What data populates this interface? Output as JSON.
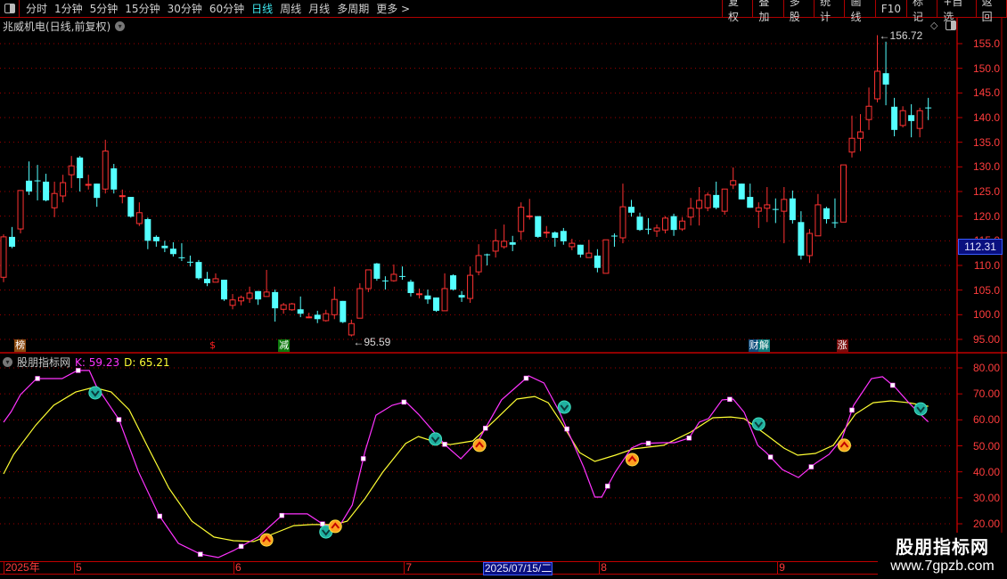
{
  "toolbar": {
    "periods": [
      "分时",
      "1分钟",
      "5分钟",
      "15分钟",
      "30分钟",
      "60分钟",
      "日线",
      "周线",
      "月线",
      "多周期",
      "更多 >"
    ],
    "active_period": "日线",
    "buttons": [
      "复权",
      "叠加",
      "多股",
      "统计",
      "画线",
      "F10",
      "标记",
      "+自选",
      "返回"
    ]
  },
  "chart_title": "兆威机电(日线,前复权)",
  "indicator": {
    "name": "股朋指标网",
    "k_label": "K: 59.23",
    "d_label": "D: 65.21"
  },
  "price_axis": {
    "labels": [
      "155.0",
      "150.0",
      "145.0",
      "140.0",
      "135.0",
      "130.0",
      "125.0",
      "120.0",
      "115.0",
      "110.0",
      "105.0",
      "100.0",
      "95.00"
    ],
    "current_price": "112.31"
  },
  "indicator_axis": {
    "labels": [
      "80.00",
      "70.00",
      "60.00",
      "50.00",
      "40.00",
      "30.00",
      "20.00"
    ]
  },
  "annotations": {
    "high": "156.72",
    "low": "95.59"
  },
  "event_marks": [
    {
      "text": "榜",
      "bar": 1.9,
      "bg": "#8b4a10",
      "color": "#ffffff"
    },
    {
      "text": "$",
      "bar": 24.8,
      "bg": "transparent",
      "color": "#ff2020"
    },
    {
      "text": "减",
      "bar": 33,
      "bg": "#0c7a0c",
      "color": "#ffffff"
    },
    {
      "text": "财",
      "bar": 88.4,
      "bg": "#0c4a7a",
      "color": "#ffffff"
    },
    {
      "text": "解",
      "bar": 89.6,
      "bg": "#0c7a7a",
      "color": "#ffffff"
    },
    {
      "text": "涨",
      "bar": 98.8,
      "bg": "#7a0c0c",
      "color": "#ffffff"
    }
  ],
  "time_axis": [
    {
      "text": "2025年",
      "bar": 0
    },
    {
      "text": "5",
      "bar": 8.3
    },
    {
      "text": "6",
      "bar": 27.1
    },
    {
      "text": "7",
      "bar": 47.2
    },
    {
      "text": "2025/07/15/二",
      "bar": 56.5,
      "selected": true
    },
    {
      "text": "8",
      "bar": 70.2
    },
    {
      "text": "9",
      "bar": 91.2
    }
  ],
  "watermark": {
    "line1": "股朋指标网",
    "line2": "www.7gpzb.com"
  },
  "colors": {
    "up": "#ff3232",
    "down": "#54ffff",
    "k": "#ff33ff",
    "d": "#ffff33",
    "grid": "#a00000",
    "signal_buy": "#ffa020",
    "signal_sell": "#20b0a0"
  },
  "chart_data": {
    "type": "candlestick",
    "price_range": [
      95,
      155
    ],
    "ohlc": [
      [
        107.6,
        116.3,
        106.6,
        115.8
      ],
      [
        115.8,
        117.8,
        113.5,
        113.8
      ],
      [
        117.4,
        125.2,
        116.5,
        125.2
      ],
      [
        127.2,
        131.1,
        124.3,
        125
      ],
      [
        127.25,
        130.4,
        123.2,
        127.2
      ],
      [
        127,
        128.6,
        123,
        123.2
      ],
      [
        121.7,
        127,
        119.8,
        124.6
      ],
      [
        124.1,
        128.4,
        122.8,
        126.8
      ],
      [
        128.4,
        132.2,
        125.7,
        130.2
      ],
      [
        131.9,
        132.2,
        125,
        127.7
      ],
      [
        126.4,
        128.4,
        125.4,
        126.45
      ],
      [
        126.6,
        126.6,
        121.9,
        123.7
      ],
      [
        125.5,
        135.5,
        124.6,
        133.2
      ],
      [
        129.7,
        130.6,
        124.6,
        125.4
      ],
      [
        124.1,
        125.4,
        122.6,
        124.15
      ],
      [
        123.9,
        123.9,
        119.7,
        119.9
      ],
      [
        118.5,
        122.8,
        118,
        120.7
      ],
      [
        119.4,
        119.7,
        113.3,
        115
      ],
      [
        115.8,
        116.1,
        113.8,
        114.9
      ],
      [
        114,
        115,
        112.7,
        113.5
      ],
      [
        113.4,
        114.7,
        111.8,
        112.3
      ],
      [
        111.65,
        114.5,
        110.9,
        111.6
      ],
      [
        110.75,
        112,
        109.8,
        110.7
      ],
      [
        110.7,
        111.1,
        107.1,
        107.4
      ],
      [
        107.3,
        108.7,
        105.8,
        106.4
      ],
      [
        106.6,
        108.4,
        106.6,
        107.3
      ],
      [
        107.1,
        107.1,
        102.8,
        103.1
      ],
      [
        101.9,
        104.2,
        101.1,
        103
      ],
      [
        102.8,
        103.9,
        101.9,
        103.5
      ],
      [
        103.3,
        105.7,
        102.4,
        104.4
      ],
      [
        104.8,
        104.8,
        102,
        103.1
      ],
      [
        103.7,
        109.1,
        103.7,
        104.6
      ],
      [
        104.6,
        105.1,
        98.6,
        101.3
      ],
      [
        101.1,
        102.4,
        100.2,
        102
      ],
      [
        101,
        102.4,
        100.8,
        102.2
      ],
      [
        101.1,
        103.7,
        99.5,
        100.2
      ],
      [
        99.5,
        100.4,
        99.3,
        99.55
      ],
      [
        100,
        100.8,
        98.3,
        99.1
      ],
      [
        98.8,
        101,
        98.6,
        100.2
      ],
      [
        100,
        105.7,
        99.1,
        103.1
      ],
      [
        102.8,
        102.8,
        98.3,
        98.5
      ],
      [
        95.9,
        99,
        95.59,
        98.2
      ],
      [
        99.3,
        106.4,
        99.3,
        105.3
      ],
      [
        105.3,
        109.1,
        104.6,
        109.1
      ],
      [
        110.4,
        110.5,
        106.9,
        107.3
      ],
      [
        106.95,
        107.8,
        105.1,
        106.9
      ],
      [
        106.9,
        110.2,
        106.7,
        108.2
      ],
      [
        107.85,
        109.8,
        107.1,
        107.8
      ],
      [
        106.7,
        107.1,
        103.7,
        104.4
      ],
      [
        104.2,
        105.3,
        103.3,
        104.25
      ],
      [
        103.9,
        105.1,
        102.2,
        103.1
      ],
      [
        103.5,
        103.5,
        100.6,
        100.8
      ],
      [
        100.8,
        108.4,
        100.8,
        105.3
      ],
      [
        108,
        108.2,
        104.9,
        105.1
      ],
      [
        104,
        104.8,
        102.6,
        103.5
      ],
      [
        103.3,
        109.8,
        102.4,
        108
      ],
      [
        108.7,
        114.3,
        108,
        112
      ],
      [
        112.25,
        112.4,
        110,
        112.2
      ],
      [
        112.9,
        117.4,
        111.6,
        115
      ],
      [
        113.8,
        118.3,
        113.4,
        114.9
      ],
      [
        114.7,
        116,
        112.9,
        114.2
      ],
      [
        116.9,
        122.8,
        115.2,
        121.8
      ],
      [
        120,
        123.5,
        119.3,
        120.05
      ],
      [
        120,
        120,
        115.6,
        115.8
      ],
      [
        116.7,
        118,
        115.6,
        116.75
      ],
      [
        116.7,
        116.9,
        113.8,
        115.6
      ],
      [
        117,
        117.6,
        114.2,
        114.9
      ],
      [
        113.8,
        115.4,
        113.1,
        114.5
      ],
      [
        114.2,
        114.2,
        111.6,
        112.2
      ],
      [
        111.6,
        115.2,
        111.6,
        112.5
      ],
      [
        112,
        113.3,
        108.6,
        109.5
      ],
      [
        108.4,
        115.2,
        108.4,
        115.2
      ],
      [
        116.05,
        116.5,
        113.8,
        116
      ],
      [
        115.6,
        126.6,
        114.5,
        121.9
      ],
      [
        121.9,
        123.3,
        119.9,
        120.7
      ],
      [
        119.9,
        120.7,
        117,
        117.2
      ],
      [
        117.45,
        119.6,
        116.3,
        117.4
      ],
      [
        117,
        118.3,
        115.8,
        117.6
      ],
      [
        117.2,
        120,
        116.5,
        119.6
      ],
      [
        120,
        120.5,
        116,
        117.2
      ],
      [
        117.4,
        119.8,
        117,
        119
      ],
      [
        119.8,
        123.7,
        118.1,
        121.6
      ],
      [
        121.6,
        125.9,
        118.1,
        123.2
      ],
      [
        121.7,
        124.8,
        121,
        124.3
      ],
      [
        124.3,
        127,
        121.4,
        121.7
      ],
      [
        121,
        125.5,
        120.3,
        125.5
      ],
      [
        126.3,
        129.9,
        125.5,
        127.2
      ],
      [
        126.6,
        126.6,
        123.4,
        123.4
      ],
      [
        123.9,
        126.6,
        121.7,
        121.7
      ],
      [
        121,
        122.8,
        117.6,
        121.7
      ],
      [
        121.6,
        125.9,
        118.8,
        122.3
      ],
      [
        121.45,
        123.6,
        118.6,
        121.4
      ],
      [
        121,
        125.9,
        114.5,
        123.4
      ],
      [
        123.6,
        125.2,
        118.5,
        119.2
      ],
      [
        118.8,
        121,
        111.2,
        112
      ],
      [
        112,
        117.4,
        110.5,
        116.5
      ],
      [
        116,
        124.5,
        116,
        122.3
      ],
      [
        121.6,
        121.9,
        118.5,
        119.4
      ],
      [
        118.75,
        123.6,
        117.6,
        118.7
      ],
      [
        118.8,
        130.4,
        118.8,
        130.4
      ],
      [
        133,
        140.4,
        131.9,
        135.8
      ],
      [
        135.8,
        140.7,
        133.2,
        137.1
      ],
      [
        139.6,
        146.1,
        137.5,
        142.3
      ],
      [
        143.8,
        156.72,
        143.1,
        149.4
      ],
      [
        149,
        155.4,
        142.5,
        146.7
      ],
      [
        142.2,
        144,
        136.2,
        137.5
      ],
      [
        138.4,
        142.3,
        138,
        141.4
      ],
      [
        140.5,
        142.7,
        136,
        139.3
      ],
      [
        137.8,
        142,
        136,
        141.4
      ],
      [
        142.05,
        144,
        139.5,
        142
      ]
    ],
    "high_bar": 103,
    "low_bar": 41,
    "indicator": {
      "range": [
        13,
        85
      ],
      "k": [
        [
          0,
          59.1
        ],
        [
          0.9,
          63.2
        ],
        [
          2,
          69.7
        ],
        [
          3.9,
          75.9
        ],
        [
          6.9,
          75.9
        ],
        [
          8.7,
          79
        ],
        [
          10.1,
          79
        ],
        [
          10.9,
          73.2
        ],
        [
          13.6,
          60.1
        ],
        [
          15.9,
          40
        ],
        [
          18.3,
          23.4
        ],
        [
          20.6,
          12.5
        ],
        [
          23.2,
          8.3
        ],
        [
          25.3,
          7
        ],
        [
          27.1,
          9.7
        ],
        [
          30,
          14.9
        ],
        [
          33,
          23.8
        ],
        [
          35.8,
          23.8
        ],
        [
          37.9,
          19.3
        ],
        [
          39.7,
          19.7
        ],
        [
          41.1,
          27.2
        ],
        [
          42.6,
          47.8
        ],
        [
          43.9,
          61.8
        ],
        [
          45.8,
          65.6
        ],
        [
          47.4,
          67
        ],
        [
          48.9,
          62.2
        ],
        [
          52.1,
          50.2
        ],
        [
          53.9,
          45
        ],
        [
          56,
          52.2
        ],
        [
          58.7,
          67.7
        ],
        [
          61.9,
          76.9
        ],
        [
          63.7,
          74.2
        ],
        [
          65.5,
          63.2
        ],
        [
          68.4,
          41.6
        ],
        [
          69.7,
          30.3
        ],
        [
          70.5,
          30.3
        ],
        [
          72.1,
          39.9
        ],
        [
          74,
          49.1
        ],
        [
          75.2,
          50.9
        ],
        [
          77.7,
          51.2
        ],
        [
          79.1,
          51.2
        ],
        [
          80.8,
          53
        ],
        [
          82,
          59.1
        ],
        [
          83.1,
          60.5
        ],
        [
          84.7,
          67.7
        ],
        [
          86,
          68
        ],
        [
          87.3,
          62.9
        ],
        [
          88.9,
          50.2
        ],
        [
          89.9,
          47.4
        ],
        [
          91.8,
          40.9
        ],
        [
          93.7,
          37.8
        ],
        [
          95.7,
          43.3
        ],
        [
          97.3,
          46.7
        ],
        [
          98.8,
          52.6
        ],
        [
          100.2,
          65.6
        ],
        [
          102.3,
          75.9
        ],
        [
          103.6,
          76.6
        ],
        [
          105.1,
          72.5
        ],
        [
          106.7,
          66.6
        ],
        [
          108.8,
          59.8
        ],
        [
          109,
          59.23
        ]
      ],
      "d": [
        [
          0,
          39.2
        ],
        [
          1.2,
          46.7
        ],
        [
          3.8,
          58
        ],
        [
          5.9,
          65.6
        ],
        [
          8.5,
          70.7
        ],
        [
          10.6,
          72.5
        ],
        [
          12.7,
          70.7
        ],
        [
          14.8,
          63.9
        ],
        [
          16.9,
          50.2
        ],
        [
          19.5,
          33.7
        ],
        [
          22.2,
          21
        ],
        [
          24.8,
          14.9
        ],
        [
          27.1,
          13.5
        ],
        [
          29.5,
          13.2
        ],
        [
          31.6,
          15.9
        ],
        [
          34.2,
          19.3
        ],
        [
          36.3,
          19.7
        ],
        [
          39,
          19.7
        ],
        [
          40.5,
          21
        ],
        [
          42.6,
          29.7
        ],
        [
          44.7,
          39.9
        ],
        [
          47.4,
          50.9
        ],
        [
          48.9,
          53.6
        ],
        [
          50.5,
          51.9
        ],
        [
          52.6,
          50.5
        ],
        [
          55.3,
          51.9
        ],
        [
          57.9,
          59.8
        ],
        [
          60.5,
          68
        ],
        [
          62.6,
          69
        ],
        [
          64.2,
          66.6
        ],
        [
          65.8,
          58.7
        ],
        [
          67.9,
          47.4
        ],
        [
          69.7,
          44
        ],
        [
          72.1,
          46.4
        ],
        [
          74.2,
          48.8
        ],
        [
          77.8,
          50.2
        ],
        [
          81,
          55.3
        ],
        [
          83.6,
          60.8
        ],
        [
          85.7,
          61.1
        ],
        [
          87.3,
          60.5
        ],
        [
          89.9,
          54.3
        ],
        [
          92,
          49.1
        ],
        [
          93.6,
          46.4
        ],
        [
          95.7,
          47.1
        ],
        [
          97.8,
          50.2
        ],
        [
          100.4,
          62.2
        ],
        [
          102.5,
          66.6
        ],
        [
          104.6,
          67.3
        ],
        [
          106.7,
          66.6
        ],
        [
          109,
          65.21
        ]
      ],
      "signals": [
        {
          "type": "sell",
          "bar": 10.8,
          "value": 70.4
        },
        {
          "type": "sell",
          "bar": 38,
          "value": 16.9
        },
        {
          "type": "sell",
          "bar": 50.9,
          "value": 52.6
        },
        {
          "type": "sell",
          "bar": 66.1,
          "value": 64.9
        },
        {
          "type": "sell",
          "bar": 89,
          "value": 58.4
        },
        {
          "type": "sell",
          "bar": 108.1,
          "value": 64.2
        },
        {
          "type": "buy",
          "bar": 31,
          "value": 13.8
        },
        {
          "type": "buy",
          "bar": 39.1,
          "value": 19
        },
        {
          "type": "buy",
          "bar": 56.1,
          "value": 50.2
        },
        {
          "type": "buy",
          "bar": 74.1,
          "value": 44.7
        },
        {
          "type": "buy",
          "bar": 99.1,
          "value": 50.2
        }
      ]
    }
  }
}
